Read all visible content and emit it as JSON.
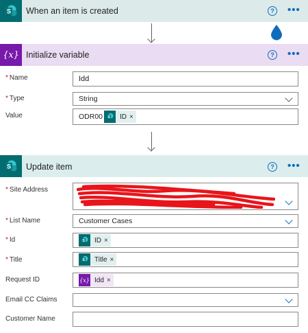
{
  "trigger": {
    "title": "When an item is created",
    "help_glyph": "?",
    "menu_glyph": "•••",
    "icon": "sharepoint-icon",
    "color": "#036c70"
  },
  "init_variable": {
    "title": "Initialize variable",
    "help_glyph": "?",
    "menu_glyph": "•••",
    "icon": "variable-icon",
    "icon_glyph": "{x}",
    "header_bg": "#eadcf2",
    "fields": {
      "name": {
        "label": "Name",
        "required": "*",
        "value": "Idd"
      },
      "type": {
        "label": "Type",
        "required": "*",
        "value": "String"
      },
      "value": {
        "label": "Value",
        "prefix": "ODR00",
        "token_label": "ID",
        "token_remove": "×"
      }
    }
  },
  "update_item": {
    "title": "Update item",
    "help_glyph": "?",
    "menu_glyph": "•••",
    "icon": "sharepoint-icon",
    "header_bg": "#dbeeed",
    "fields": {
      "site_address": {
        "label": "Site Address",
        "required": "*"
      },
      "list_name": {
        "label": "List Name",
        "required": "*",
        "value": "Customer Cases"
      },
      "id": {
        "label": "Id",
        "required": "*",
        "token_label": "ID",
        "token_remove": "×"
      },
      "title": {
        "label": "Title",
        "required": "*",
        "token_label": "Title",
        "token_remove": "×"
      },
      "request_id": {
        "label": "Request ID",
        "token_label": "Idd",
        "token_remove": "×",
        "token_icon_glyph": "{x}"
      },
      "email_cc_claims": {
        "label": "Email CC Claims"
      },
      "customer_name": {
        "label": "Customer Name"
      }
    }
  },
  "colors": {
    "accent": "#0f6cbd",
    "sharepoint": "#036c70",
    "variable": "#7719aa",
    "redaction": "#e8151b",
    "required": "#a4262c"
  }
}
